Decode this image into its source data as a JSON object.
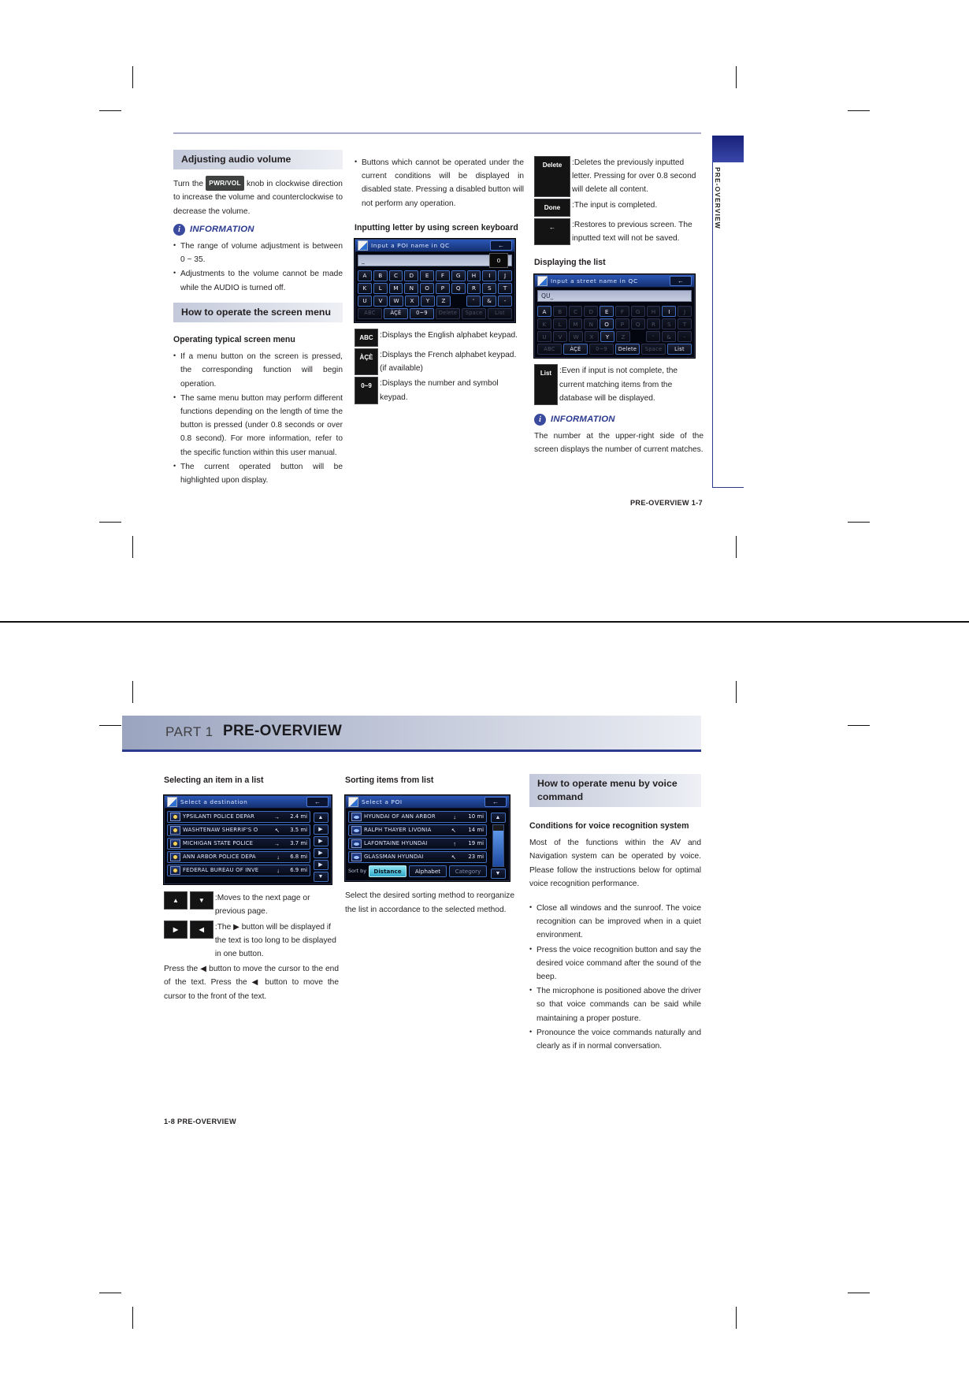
{
  "page1": {
    "side_tab_label": "PRE-OVERVIEW",
    "footer": "PRE-OVERVIEW   1-7",
    "col1": {
      "section_heading": "Adjusting audio volume",
      "body1_pre": "Turn the ",
      "body1_kbd": "PWR/VOL",
      "body1_post": " knob in clockwise direction to increase the volume and counterclockwise to decrease the volume.",
      "information_label": "INFORMATION",
      "info_items": [
        "The range of volume adjustment is between 0 ~ 35.",
        "Adjustments to the volume cannot be made while the AUDIO is turned off."
      ],
      "section_heading2": "How to operate the screen menu",
      "sub_heading": "Operating typical screen menu",
      "bullets": [
        "If a menu button on the screen is pressed, the corresponding function will begin operation.",
        "The same menu button may perform different functions depending on the length of time the button is pressed (under 0.8 seconds or over 0.8 second). For more information, refer to the specific function within this user manual.",
        "The current operated button will be highlighted upon display."
      ]
    },
    "col2": {
      "bullet1": "Buttons which cannot be operated under the current conditions will be displayed in disabled state. Pressing a disabled button will not perform any operation.",
      "sub_heading": "Inputting letter by using screen keyboard",
      "keyboard": {
        "title": "Input a POI name in QC",
        "input_value": "_",
        "count": "0",
        "back_icon": "←",
        "rows": [
          [
            "A",
            "B",
            "C",
            "D",
            "E",
            "F",
            "G",
            "H",
            "I",
            "J"
          ],
          [
            "K",
            "L",
            "M",
            "N",
            "O",
            "P",
            "Q",
            "R",
            "S",
            "T"
          ],
          [
            "U",
            "V",
            "W",
            "X",
            "Y",
            "Z",
            "",
            "'",
            "&",
            "-"
          ]
        ],
        "function_keys": [
          "ABC",
          "ÀÇÈ",
          "0~9",
          "Delete",
          "Space",
          "List"
        ]
      },
      "legend": [
        {
          "key": "ABC",
          "text": "Displays the English alphabet keypad."
        },
        {
          "key": "ÀÇÈ",
          "text": "Displays the French alphabet keypad. (if available)"
        },
        {
          "key": "0~9",
          "text": "Displays the number and symbol keypad."
        }
      ]
    },
    "col3": {
      "legend": [
        {
          "key": "Delete",
          "text": "Deletes the previously inputted letter. Pressing for over 0.8 second will delete all content."
        },
        {
          "key": "Done",
          "text": "The input is completed."
        },
        {
          "key": "←",
          "text": "Restores to previous screen. The inputted text will not be saved."
        }
      ],
      "sub_heading": "Displaying the list",
      "keyboard": {
        "title": "Input a street name in QC",
        "input_value": "QU_",
        "back_icon": "←",
        "rows": [
          [
            {
              "l": "A",
              "on": true
            },
            {
              "l": "B",
              "on": false
            },
            {
              "l": "C",
              "on": false
            },
            {
              "l": "D",
              "on": false
            },
            {
              "l": "E",
              "on": true
            },
            {
              "l": "F",
              "on": false
            },
            {
              "l": "G",
              "on": false
            },
            {
              "l": "H",
              "on": false
            },
            {
              "l": "I",
              "on": true
            },
            {
              "l": "J",
              "on": false
            }
          ],
          [
            {
              "l": "K",
              "on": false
            },
            {
              "l": "L",
              "on": false
            },
            {
              "l": "M",
              "on": false
            },
            {
              "l": "N",
              "on": false
            },
            {
              "l": "O",
              "on": true
            },
            {
              "l": "P",
              "on": false
            },
            {
              "l": "Q",
              "on": false
            },
            {
              "l": "R",
              "on": false
            },
            {
              "l": "S",
              "on": false
            },
            {
              "l": "T",
              "on": false
            }
          ],
          [
            {
              "l": "U",
              "on": false
            },
            {
              "l": "V",
              "on": false
            },
            {
              "l": "W",
              "on": false
            },
            {
              "l": "X",
              "on": false
            },
            {
              "l": "Y",
              "on": true
            },
            {
              "l": "Z",
              "on": false
            },
            {
              "l": "",
              "on": false
            },
            {
              "l": "'",
              "on": false
            },
            {
              "l": "&",
              "on": false
            },
            {
              "l": "-",
              "on": false
            }
          ]
        ],
        "function_keys": [
          {
            "l": "ABC",
            "on": false
          },
          {
            "l": "ÀÇÈ",
            "on": true
          },
          {
            "l": "0~9",
            "on": false
          },
          {
            "l": "Delete",
            "on": true
          },
          {
            "l": "Space",
            "on": false
          },
          {
            "l": "List",
            "on": true
          }
        ]
      },
      "list_legend": {
        "key": "List",
        "text": "Even if input is not complete, the current matching items from the database will be displayed."
      },
      "information_label": "INFORMATION",
      "information_text": "The number at the upper-right side of the screen displays the number of current matches."
    }
  },
  "page2": {
    "banner": {
      "part": "PART 1",
      "title": "PRE-OVERVIEW"
    },
    "footer": "1-8   PRE-OVERVIEW",
    "col1": {
      "sub_heading": "Selecting an item in a list",
      "screen": {
        "title": "Select a destination",
        "back_icon": "←",
        "rows": [
          {
            "name": "YPSILANTI POLICE DEPAR",
            "dir": "→",
            "dist": "2.4 mi"
          },
          {
            "name": "WASHTENAW SHERRIF'S O",
            "dir": "↖",
            "dist": "3.5 mi"
          },
          {
            "name": "MICHIGAN STATE POLICE",
            "dir": "→",
            "dist": "3.7 mi"
          },
          {
            "name": "ANN ARBOR POLICE DEPA",
            "dir": "↓",
            "dist": "6.8 mi"
          },
          {
            "name": "FEDERAL BUREAU OF INVE",
            "dir": "↓",
            "dist": "6.9 mi"
          }
        ]
      },
      "legend": [
        {
          "keys": [
            "▲",
            "▼"
          ],
          "text": "Moves to the next page or previous page."
        },
        {
          "keys": [
            "▶",
            "◀"
          ],
          "text": "The ▶ button will be displayed if the text is too long to be displayed in one button."
        }
      ],
      "paragraph": "Press the ◀ button to move the cursor to the end of the text. Press the ◀ button to move the cursor to the front of the text."
    },
    "col2": {
      "sub_heading": "Sorting items from list",
      "screen": {
        "title": "Select a POI",
        "back_icon": "←",
        "rows": [
          {
            "name": "HYUNDAI OF ANN ARBOR",
            "dir": "↓",
            "dist": "10 mi"
          },
          {
            "name": "RALPH THAYER LIVONIA",
            "dir": "↖",
            "dist": "14 mi"
          },
          {
            "name": "LAFONTAINE HYUNDAI",
            "dir": "↑",
            "dist": "19 mi"
          },
          {
            "name": "GLASSMAN HYUNDAI",
            "dir": "↖",
            "dist": "23 mi"
          }
        ],
        "sort_label": "Sort by",
        "sort_options": [
          {
            "label": "Distance",
            "selected": true
          },
          {
            "label": "Alphabet",
            "selected": false
          },
          {
            "label": "Category",
            "selected": false
          }
        ]
      },
      "paragraph": "Select the desired sorting method to reorganize the list in accordance to the selected method."
    },
    "col3": {
      "section_heading": "How to operate menu by voice command",
      "sub_heading": "Conditions for voice recognition system",
      "paragraph": "Most of the functions within the AV and Navigation system can be operated by voice. Please follow the  instructions below for optimal voice recognition performance.",
      "bullets": [
        "Close all windows and  the sunroof. The voice recognition can be improved when in a quiet environment.",
        "Press the voice recognition button and say the desired voice command after the sound of the beep.",
        "The microphone is positioned above the driver so that voice commands can be said while maintaining a proper posture.",
        "Pronounce the voice commands naturally and clearly as if in normal conversation."
      ]
    }
  }
}
